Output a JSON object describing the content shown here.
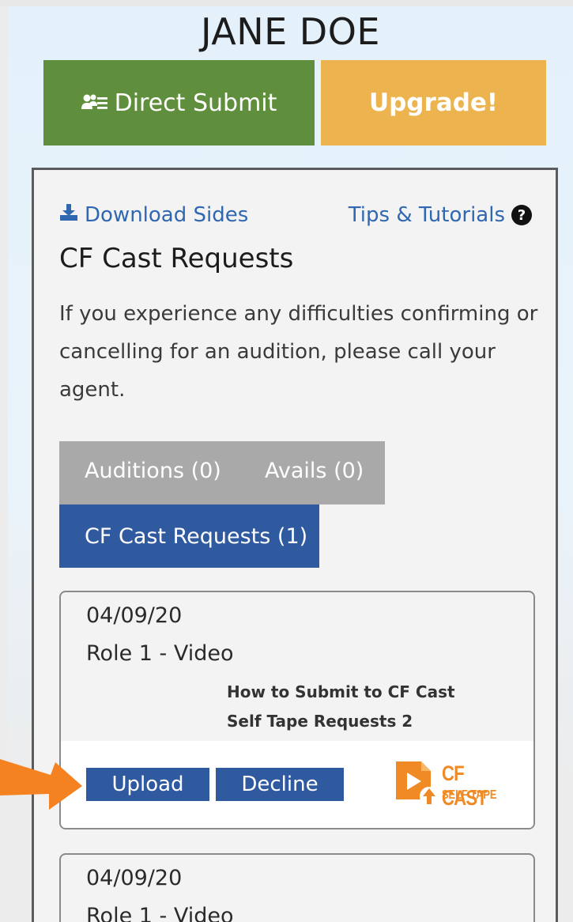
{
  "header": {
    "name": "JANE DOE",
    "direct_submit_label": "Direct Submit",
    "upgrade_label": "Upgrade!"
  },
  "panel": {
    "download_sides": "Download Sides",
    "tips_tutorials": "Tips & Tutorials",
    "section_title": "CF Cast Requests",
    "description": "If you experience any difficulties confirming or cancelling for an audition, please call your agent.",
    "tabs": [
      {
        "label": "Auditions (0)",
        "active": false
      },
      {
        "label": "Avails (0)",
        "active": false
      },
      {
        "label": "CF Cast Requests (1)",
        "active": true
      }
    ],
    "requests": [
      {
        "date": "04/09/20",
        "role": "Role 1 - Video",
        "link_line1": "How to Submit to CF Cast",
        "link_line2": "Self Tape Requests 2",
        "upload_label": "Upload",
        "decline_label": "Decline",
        "logo_line1": "CF CAST",
        "logo_line2": "SELF TAPE"
      },
      {
        "date": "04/09/20",
        "role": "Role 1 - Video"
      }
    ]
  },
  "colors": {
    "green_button": "#5f8f3c",
    "orange_button": "#edb34f",
    "blue_tab": "#2f5aa0",
    "link_blue": "#2f67b1",
    "arrow_orange": "#f58220"
  },
  "icons": [
    "users-list-icon",
    "download-icon",
    "question-circle-icon",
    "cf-cast-logo-icon",
    "pointer-arrow-icon"
  ]
}
